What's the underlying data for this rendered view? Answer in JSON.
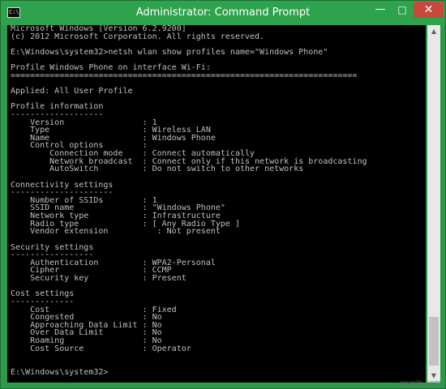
{
  "window": {
    "title": "Administrator: Command Prompt",
    "icon_name": "cmd-icon",
    "icon_label": "C:\\",
    "min_symbol": "—",
    "max_symbol": "□",
    "close_symbol": "✕",
    "accent_color": "#2ea24d",
    "close_color": "#c7493c"
  },
  "console": {
    "lines": [
      "Microsoft Windows [Version 6.2.9200]",
      "(c) 2012 Microsoft Corporation. All rights reserved.",
      "",
      "E:\\Windows\\system32>netsh wlan show profiles name=\"Windows Phone\"",
      "",
      "Profile Windows Phone on interface Wi-Fi:",
      "=======================================================================",
      "",
      "Applied: All User Profile",
      "",
      "Profile information",
      "-------------------",
      "    Version                : 1",
      "    Type                   : Wireless LAN",
      "    Name                   : Windows Phone",
      "    Control options        :",
      "        Connection mode    : Connect automatically",
      "        Network broadcast  : Connect only if this network is broadcasting",
      "        AutoSwitch         : Do not switch to other networks",
      "",
      "Connectivity settings",
      "---------------------",
      "    Number of SSIDs        : 1",
      "    SSID name              : \"Windows Phone\"",
      "    Network type           : Infrastructure",
      "    Radio type             : [ Any Radio Type ]",
      "    Vendor extension          : Not present",
      "",
      "Security settings",
      "-----------------",
      "    Authentication         : WPA2-Personal",
      "    Cipher                 : CCMP",
      "    Security key           : Present",
      "",
      "Cost settings",
      "-------------",
      "    Cost                   : Fixed",
      "    Congested              : No",
      "    Approaching Data Limit : No",
      "    Over Data Limit        : No",
      "    Roaming                : No",
      "    Cost Source            : Operator",
      "",
      "",
      "E:\\Windows\\system32>"
    ]
  },
  "scrollbar": {
    "up_symbol": "▲",
    "down_symbol": "▼"
  },
  "watermark": "wsxdn.com"
}
